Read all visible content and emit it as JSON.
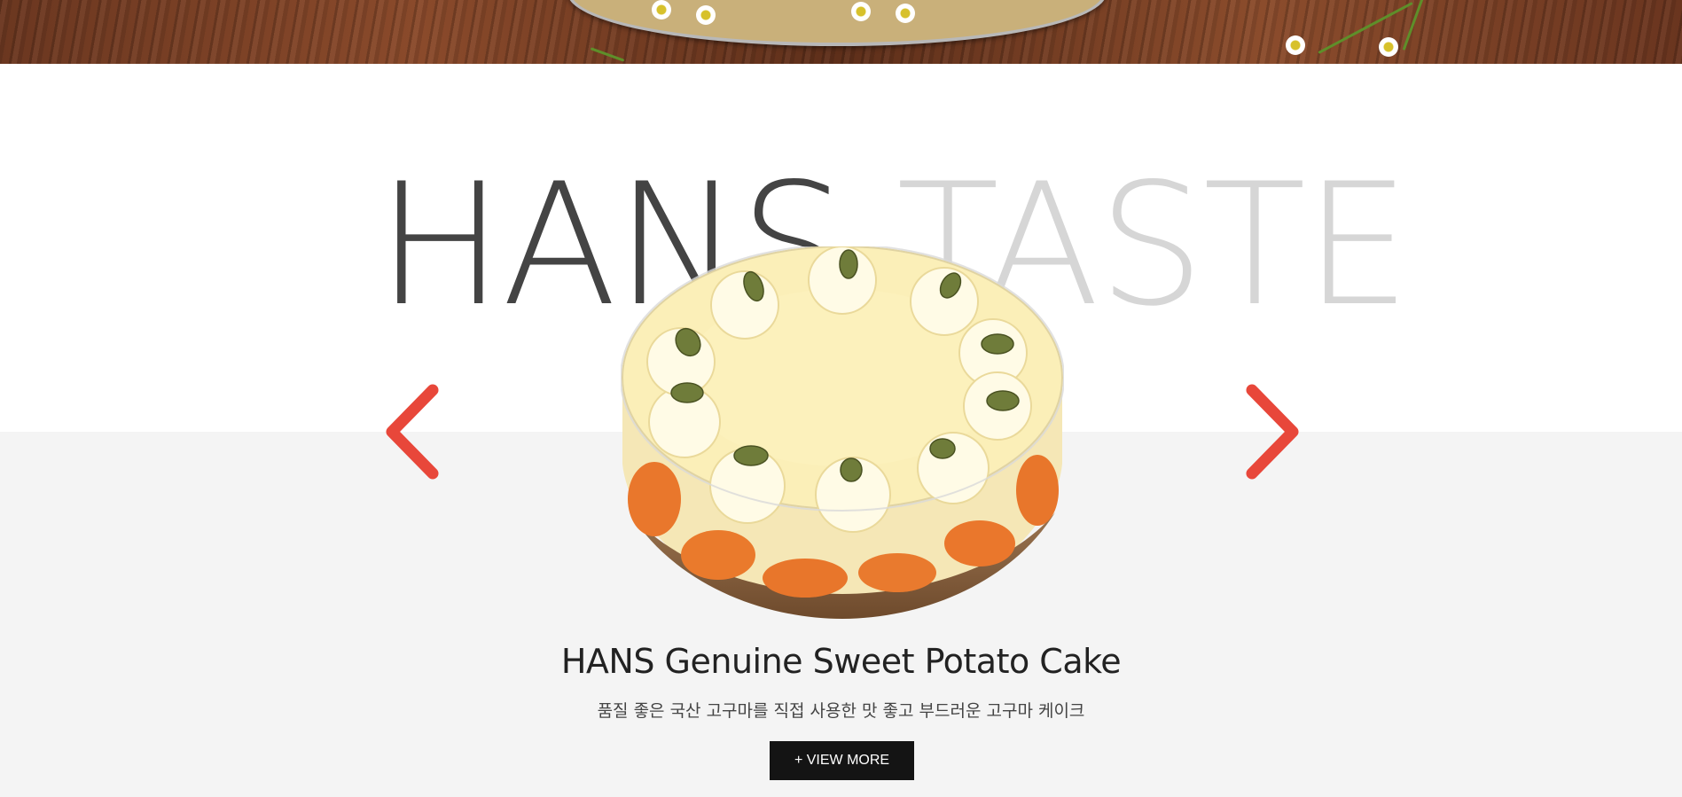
{
  "headline": {
    "part1": "HANS",
    "part2": "TASTE"
  },
  "product": {
    "title": "HANS Genuine Sweet Potato Cake",
    "description": "품질 좋은 국산 고구마를 직접 사용한 맛 좋고 부드러운 고구마 케이크",
    "image_icon": "cake-image"
  },
  "carousel": {
    "prev_icon": "chevron-left-icon",
    "next_icon": "chevron-right-icon"
  },
  "buttons": {
    "view_more": "+ VIEW MORE"
  },
  "colors": {
    "arrow": "#e8473a",
    "headline_dark": "#444444",
    "headline_light": "#d6d6d6",
    "band": "#f4f4f4",
    "button_bg": "#141414"
  }
}
